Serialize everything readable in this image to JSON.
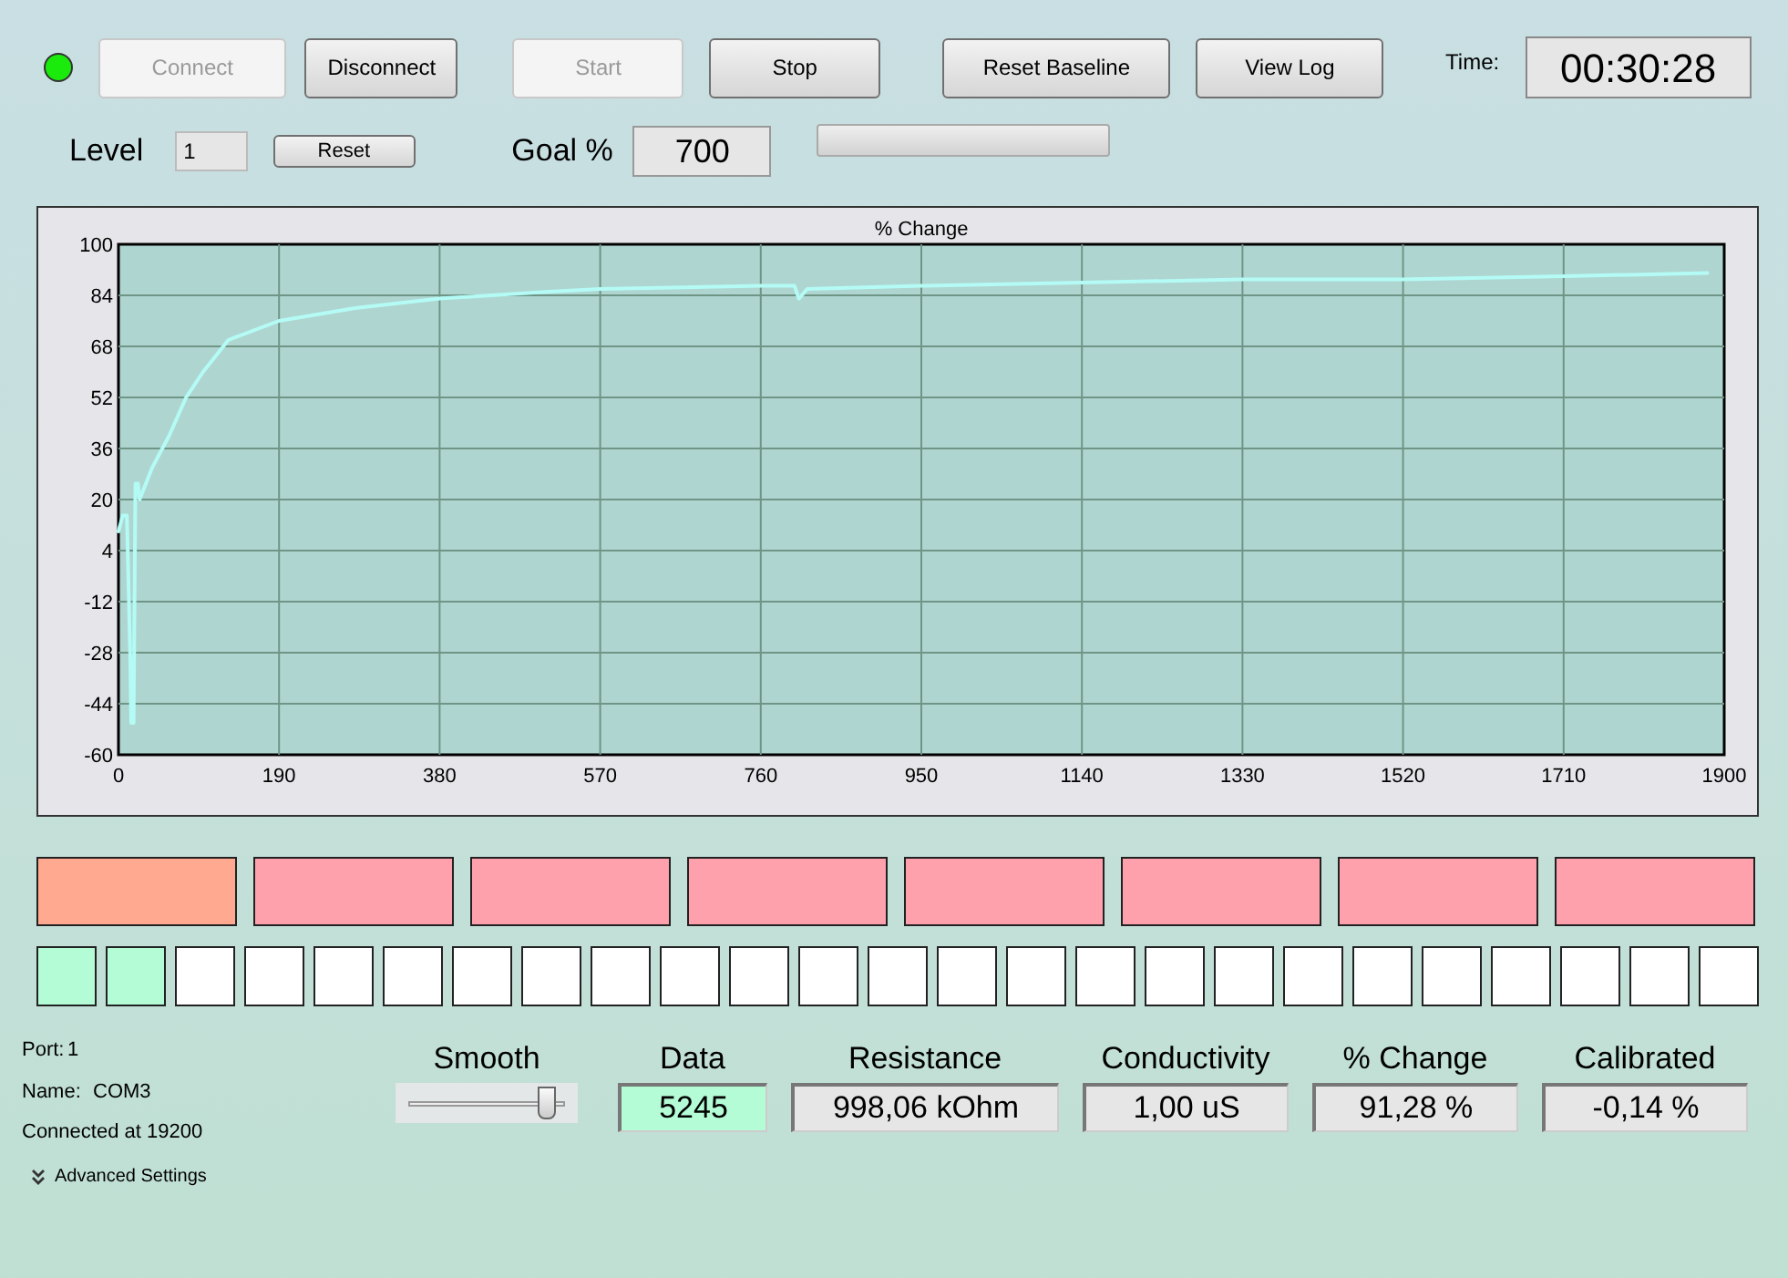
{
  "status_led": {
    "on": true
  },
  "buttons": [
    {
      "label": "Connect",
      "disabled": true
    },
    {
      "label": "Disconnect",
      "disabled": false
    },
    {
      "label": "Start",
      "disabled": true
    },
    {
      "label": "Stop",
      "disabled": false
    },
    {
      "label": "Reset Baseline",
      "disabled": false
    },
    {
      "label": "View Log",
      "disabled": false
    }
  ],
  "time": {
    "label": "Time:",
    "value": "00:30:28"
  },
  "level": {
    "label": "Level",
    "value": "1",
    "reset_button": "Reset"
  },
  "goal": {
    "label": "Goal %",
    "value": "700",
    "progress": {
      "level": 0
    }
  },
  "chart": {
    "chart_data": {
      "type": "line",
      "title": "% Change",
      "x": [
        0,
        5,
        10,
        14,
        15,
        18,
        20,
        23,
        25,
        40,
        60,
        80,
        100,
        130,
        190,
        280,
        380,
        500,
        570,
        760,
        800,
        805,
        815,
        950,
        1140,
        1330,
        1520,
        1710,
        1880
      ],
      "grid": true,
      "series": [
        {
          "color": "#b4fbf6",
          "values": [
            10,
            15,
            15,
            -30,
            -50,
            -50,
            25,
            25,
            20,
            30,
            40,
            52,
            60,
            70,
            76,
            80,
            83,
            85,
            86,
            87,
            87,
            83,
            86,
            87,
            88,
            89,
            89,
            90,
            91
          ]
        }
      ],
      "xlim": [
        0,
        1900
      ],
      "ylim": [
        -60,
        100
      ],
      "xticks": [
        0,
        190,
        380,
        570,
        760,
        950,
        1140,
        1330,
        1520,
        1710,
        1900
      ],
      "yticks": [
        100,
        84,
        68,
        52,
        36,
        20,
        4,
        -12,
        -28,
        -44,
        -60
      ]
    }
  },
  "blocks": [
    {
      "color": "#ffaa90"
    },
    {
      "color": "#ffa0ad"
    },
    {
      "color": "#ffa0ad"
    },
    {
      "color": "#ffa0ad"
    },
    {
      "color": "#ffa0ad"
    },
    {
      "color": "#ffa0ad"
    },
    {
      "color": "#ffa0ad"
    },
    {
      "color": "#ffa0ad"
    }
  ],
  "cells": [
    {
      "color": "#b4fcd6"
    },
    {
      "color": "#b4fcd6"
    },
    {
      "color": "#ffffff"
    },
    {
      "color": "#ffffff"
    },
    {
      "color": "#ffffff"
    },
    {
      "color": "#ffffff"
    },
    {
      "color": "#ffffff"
    },
    {
      "color": "#ffffff"
    },
    {
      "color": "#ffffff"
    },
    {
      "color": "#ffffff"
    },
    {
      "color": "#ffffff"
    },
    {
      "color": "#ffffff"
    },
    {
      "color": "#ffffff"
    },
    {
      "color": "#ffffff"
    },
    {
      "color": "#ffffff"
    },
    {
      "color": "#ffffff"
    },
    {
      "color": "#ffffff"
    },
    {
      "color": "#ffffff"
    },
    {
      "color": "#ffffff"
    },
    {
      "color": "#ffffff"
    },
    {
      "color": "#ffffff"
    },
    {
      "color": "#ffffff"
    },
    {
      "color": "#ffffff"
    },
    {
      "color": "#ffffff"
    },
    {
      "color": "#ffffff"
    }
  ],
  "connection": {
    "port_label": "Port:",
    "port": "1",
    "name_label": "Name:",
    "name": "COM3",
    "status": "Connected at 19200",
    "advanced": "Advanced Settings"
  },
  "smooth": {
    "label": "Smooth",
    "level": 0.88
  },
  "readouts": [
    {
      "label": "Data",
      "value": "5245",
      "color": "#b4fcd6"
    },
    {
      "label": "Resistance",
      "value": "998,06 kOhm",
      "color": "#e6e6e6"
    },
    {
      "label": "Conductivity",
      "value": "1,00 uS",
      "color": "#e6e6e6"
    },
    {
      "label": "% Change",
      "value": "91,28 %",
      "color": "#e6e6e6"
    },
    {
      "label": "Calibrated",
      "value": "-0,14 %",
      "color": "#e6e6e6"
    }
  ]
}
